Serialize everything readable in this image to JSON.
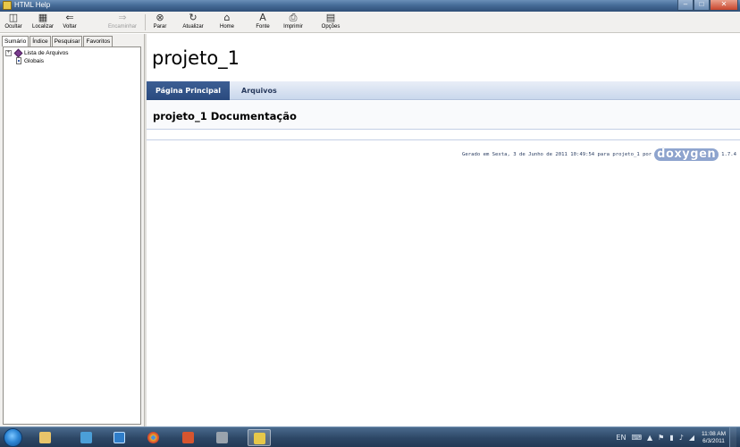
{
  "window": {
    "title": "HTML Help"
  },
  "toolbar": {
    "buttons": [
      {
        "label": "Ocultar",
        "icon": "hide-icon"
      },
      {
        "label": "Localizar",
        "icon": "locate-icon"
      },
      {
        "label": "Voltar",
        "icon": "back-arrow-icon"
      },
      {
        "label": "Encaminhar",
        "icon": "forward-arrow-icon",
        "disabled": true
      },
      {
        "label": "Parar",
        "icon": "stop-icon"
      },
      {
        "label": "Atualizar",
        "icon": "refresh-icon"
      },
      {
        "label": "Home",
        "icon": "home-icon"
      },
      {
        "label": "Fonte",
        "icon": "font-icon"
      },
      {
        "label": "Imprimir",
        "icon": "print-icon"
      },
      {
        "label": "Opções",
        "icon": "options-icon"
      }
    ]
  },
  "navpane": {
    "tabs": [
      "Sumário",
      "Índice",
      "Pesquisar",
      "Favoritos"
    ],
    "tree": [
      {
        "label": "Lista de Arquivos",
        "expander": "+",
        "icon": "book-icon"
      },
      {
        "label": "Globais",
        "icon": "page-icon"
      }
    ]
  },
  "content": {
    "project_title": "projeto_1",
    "tabs": [
      "Página Principal",
      "Arquivos"
    ],
    "heading": "projeto_1 Documentação",
    "footer_text": "Gerado em Sexta, 3 de Junho de 2011 10:49:54 para projeto_1 por",
    "footer_logo": "doxygen",
    "footer_version": "1.7.4"
  },
  "taskbar": {
    "tray_lang": "EN",
    "time": "11:08 AM",
    "date": "6/3/2011"
  },
  "colors": {
    "doxygen_tab_active": "#2a4a7e",
    "doxygen_tab_bar": "#c9d7ec",
    "taskbar": "#2d4766"
  }
}
